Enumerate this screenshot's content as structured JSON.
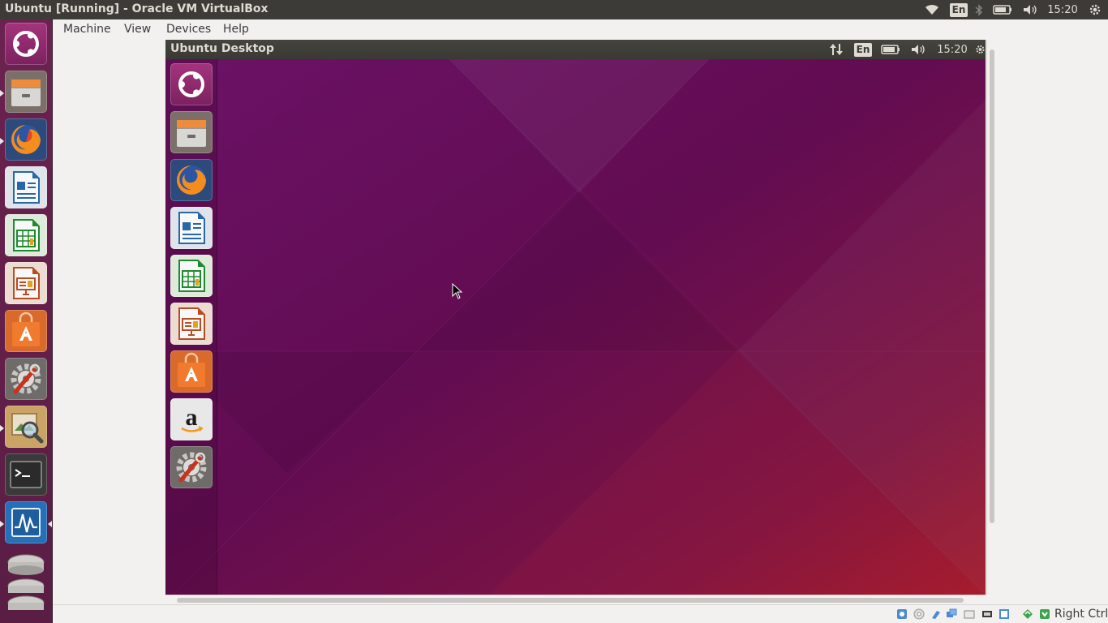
{
  "host_panel": {
    "title": "Ubuntu [Running] - Oracle VM VirtualBox",
    "keyboard": "En",
    "time": "15:20"
  },
  "host_launcher": {
    "items": [
      "dash-icon",
      "files-icon",
      "firefox-icon",
      "libreoffice-writer-icon",
      "libreoffice-calc-icon",
      "libreoffice-impress-icon",
      "ubuntu-software-icon",
      "system-settings-icon",
      "image-viewer-icon",
      "terminal-icon",
      "system-monitor-icon",
      "trash-icon"
    ]
  },
  "menubar": {
    "items": [
      "Machine",
      "View",
      "Devices",
      "Help"
    ]
  },
  "guest": {
    "title": "Ubuntu Desktop",
    "keyboard": "En",
    "time": "15:20",
    "launcher_items": [
      "dash-icon",
      "files-icon",
      "firefox-icon",
      "libreoffice-writer-icon",
      "libreoffice-calc-icon",
      "libreoffice-impress-icon",
      "ubuntu-software-icon",
      "amazon-icon",
      "system-settings-icon"
    ]
  },
  "status_bar": {
    "host_key": "Right Ctrl"
  },
  "colors": {
    "panel": "#3c3b37",
    "launcher": "#5a1d44",
    "wallpaper_top": "#65105a",
    "wallpaper_bottom": "#9e1a30",
    "vbox_bg": "#f2f1f0"
  }
}
